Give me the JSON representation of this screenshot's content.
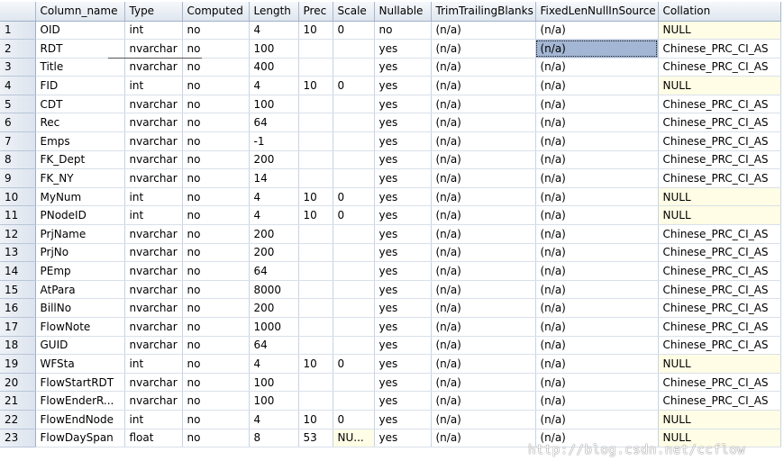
{
  "columns": [
    "Column_name",
    "Type",
    "Computed",
    "Length",
    "Prec",
    "Scale",
    "Nullable",
    "TrimTrailingBlanks",
    "FixedLenNullInSource",
    "Collation"
  ],
  "rows": [
    [
      "1",
      "OID",
      "int",
      "no",
      "4",
      "10",
      "0",
      "no",
      "(n/a)",
      "(n/a)",
      "NULL"
    ],
    [
      "2",
      "RDT",
      "nvarchar",
      "no",
      "100",
      "",
      "",
      "yes",
      "(n/a)",
      "(n/a)",
      "Chinese_PRC_CI_AS"
    ],
    [
      "3",
      "Title",
      "nvarchar",
      "no",
      "400",
      "",
      "",
      "yes",
      "(n/a)",
      "(n/a)",
      "Chinese_PRC_CI_AS"
    ],
    [
      "4",
      "FID",
      "int",
      "no",
      "4",
      "10",
      "0",
      "yes",
      "(n/a)",
      "(n/a)",
      "NULL"
    ],
    [
      "5",
      "CDT",
      "nvarchar",
      "no",
      "100",
      "",
      "",
      "yes",
      "(n/a)",
      "(n/a)",
      "Chinese_PRC_CI_AS"
    ],
    [
      "6",
      "Rec",
      "nvarchar",
      "no",
      "64",
      "",
      "",
      "yes",
      "(n/a)",
      "(n/a)",
      "Chinese_PRC_CI_AS"
    ],
    [
      "7",
      "Emps",
      "nvarchar",
      "no",
      "-1",
      "",
      "",
      "yes",
      "(n/a)",
      "(n/a)",
      "Chinese_PRC_CI_AS"
    ],
    [
      "8",
      "FK_Dept",
      "nvarchar",
      "no",
      "200",
      "",
      "",
      "yes",
      "(n/a)",
      "(n/a)",
      "Chinese_PRC_CI_AS"
    ],
    [
      "9",
      "FK_NY",
      "nvarchar",
      "no",
      "14",
      "",
      "",
      "yes",
      "(n/a)",
      "(n/a)",
      "Chinese_PRC_CI_AS"
    ],
    [
      "10",
      "MyNum",
      "int",
      "no",
      "4",
      "10",
      "0",
      "yes",
      "(n/a)",
      "(n/a)",
      "NULL"
    ],
    [
      "11",
      "PNodeID",
      "int",
      "no",
      "4",
      "10",
      "0",
      "yes",
      "(n/a)",
      "(n/a)",
      "NULL"
    ],
    [
      "12",
      "PrjName",
      "nvarchar",
      "no",
      "200",
      "",
      "",
      "yes",
      "(n/a)",
      "(n/a)",
      "Chinese_PRC_CI_AS"
    ],
    [
      "13",
      "PrjNo",
      "nvarchar",
      "no",
      "200",
      "",
      "",
      "yes",
      "(n/a)",
      "(n/a)",
      "Chinese_PRC_CI_AS"
    ],
    [
      "14",
      "PEmp",
      "nvarchar",
      "no",
      "64",
      "",
      "",
      "yes",
      "(n/a)",
      "(n/a)",
      "Chinese_PRC_CI_AS"
    ],
    [
      "15",
      "AtPara",
      "nvarchar",
      "no",
      "8000",
      "",
      "",
      "yes",
      "(n/a)",
      "(n/a)",
      "Chinese_PRC_CI_AS"
    ],
    [
      "16",
      "BillNo",
      "nvarchar",
      "no",
      "200",
      "",
      "",
      "yes",
      "(n/a)",
      "(n/a)",
      "Chinese_PRC_CI_AS"
    ],
    [
      "17",
      "FlowNote",
      "nvarchar",
      "no",
      "1000",
      "",
      "",
      "yes",
      "(n/a)",
      "(n/a)",
      "Chinese_PRC_CI_AS"
    ],
    [
      "18",
      "GUID",
      "nvarchar",
      "no",
      "64",
      "",
      "",
      "yes",
      "(n/a)",
      "(n/a)",
      "Chinese_PRC_CI_AS"
    ],
    [
      "19",
      "WFSta",
      "int",
      "no",
      "4",
      "10",
      "0",
      "yes",
      "(n/a)",
      "(n/a)",
      "NULL"
    ],
    [
      "20",
      "FlowStartRDT",
      "nvarchar",
      "no",
      "100",
      "",
      "",
      "yes",
      "(n/a)",
      "(n/a)",
      "Chinese_PRC_CI_AS"
    ],
    [
      "21",
      "FlowEnderR...",
      "nvarchar",
      "no",
      "100",
      "",
      "",
      "yes",
      "(n/a)",
      "(n/a)",
      "Chinese_PRC_CI_AS"
    ],
    [
      "22",
      "FlowEndNode",
      "int",
      "no",
      "4",
      "10",
      "0",
      "yes",
      "(n/a)",
      "(n/a)",
      "NULL"
    ],
    [
      "23",
      "FlowDaySpan",
      "float",
      "no",
      "8",
      "53",
      "NU...",
      "yes",
      "(n/a)",
      "(n/a)",
      "NULL"
    ]
  ],
  "selected_cell": {
    "row": 2,
    "column": "FixedLenNullInSource"
  },
  "watermark": "http://blog.csdn.net/ccflow",
  "colors": {
    "null_background": "#fffde5",
    "selected_background": "#a3b6d3",
    "header_gradient_top": "#f6f8fb",
    "header_gradient_bottom": "#dfe6ef"
  }
}
